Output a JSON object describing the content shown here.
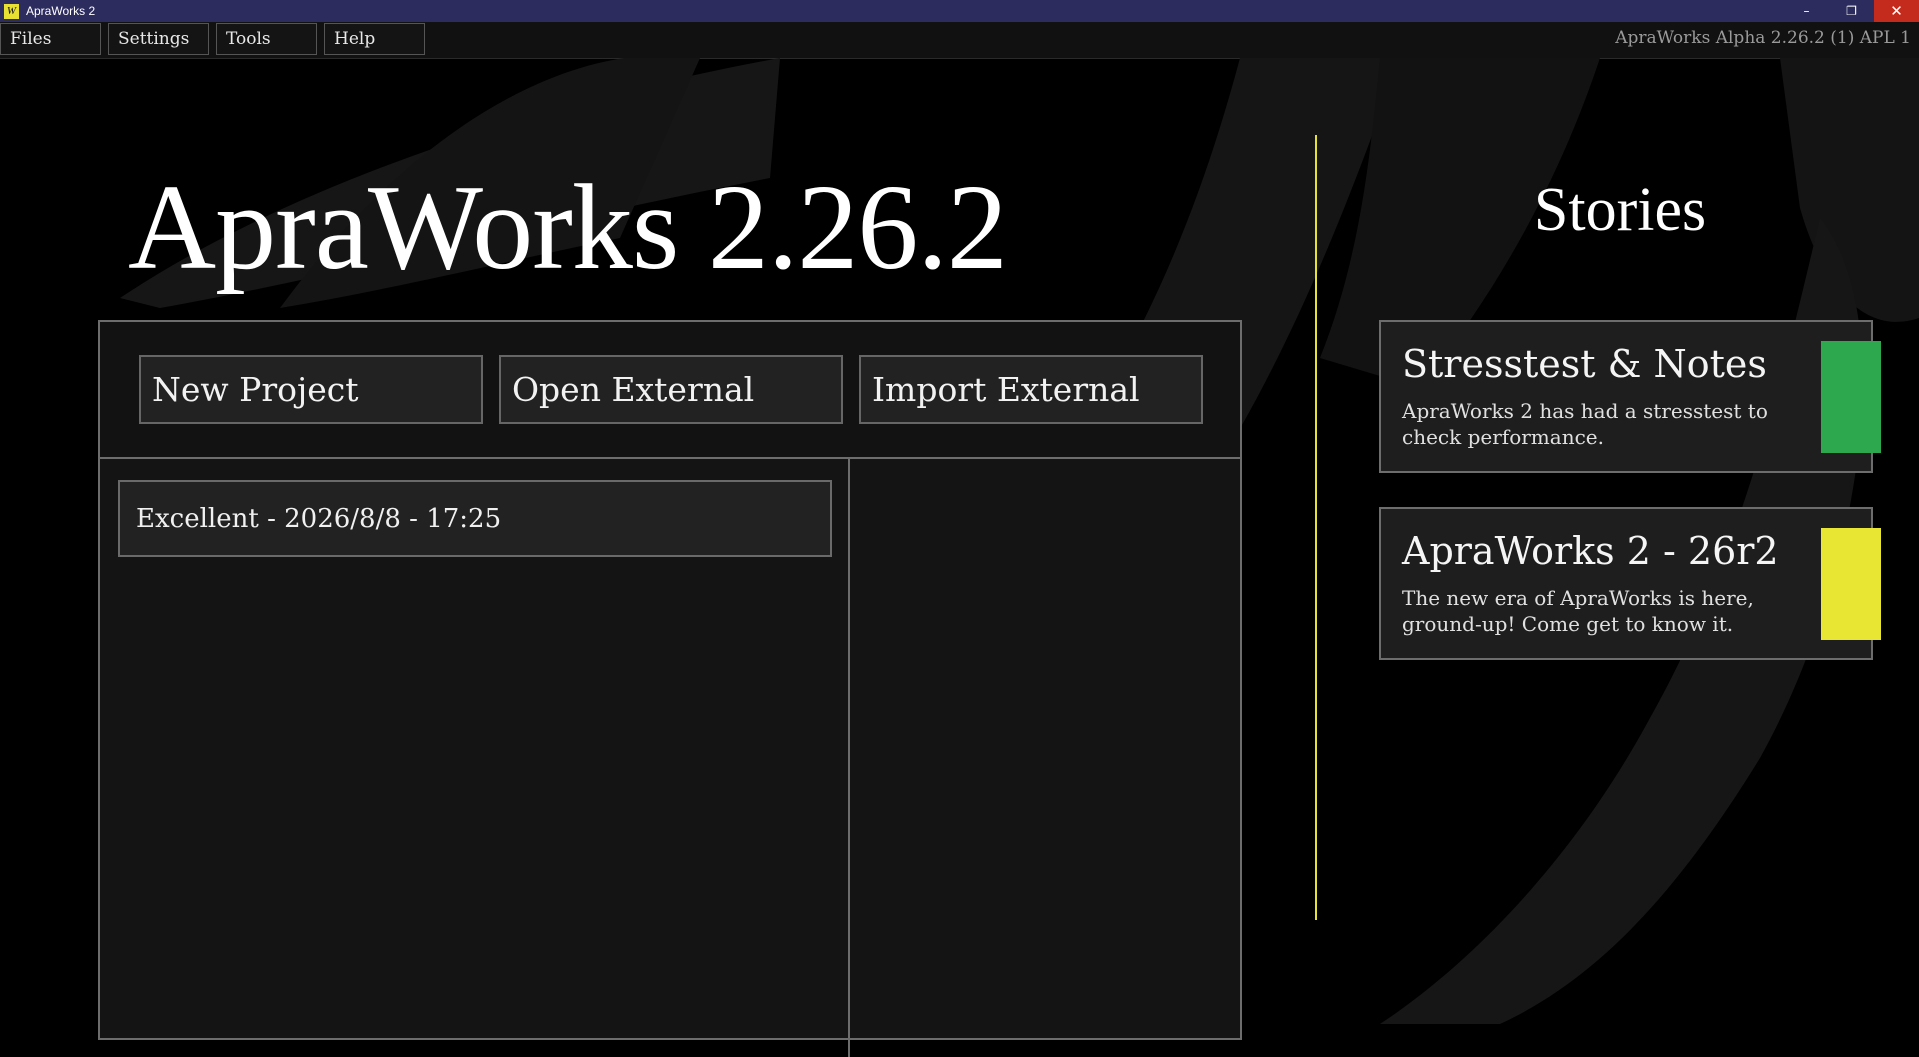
{
  "window": {
    "title": "ApraWorks 2",
    "icon_glyph": "W",
    "controls": {
      "minimize": "–",
      "restore": "❐",
      "close": "✕"
    }
  },
  "menu": {
    "items": [
      "Files",
      "Settings",
      "Tools",
      "Help"
    ],
    "version": "ApraWorks Alpha 2.26.2 (1) APL 1"
  },
  "hero": {
    "title": "ApraWorks 2.26.2"
  },
  "actions": {
    "new_project": "New Project",
    "open_external": "Open External",
    "import_external": "Import External"
  },
  "projects": [
    {
      "label": "Excellent - 2026/8/8 - 17:25"
    }
  ],
  "stories": {
    "title": "Stories",
    "items": [
      {
        "title": "Stresstest & Notes",
        "description": "ApraWorks 2 has had a stresstest to check performance.",
        "color": "#2ea84f"
      },
      {
        "title": "ApraWorks 2 - 26r2",
        "description": "The new era of ApraWorks is here, ground-up! Come get to know it.",
        "color": "#e8e533"
      }
    ]
  },
  "colors": {
    "accent_divider": "#e6e233",
    "titlebar": "#2c2c5e",
    "close_button": "#c42b1c"
  }
}
